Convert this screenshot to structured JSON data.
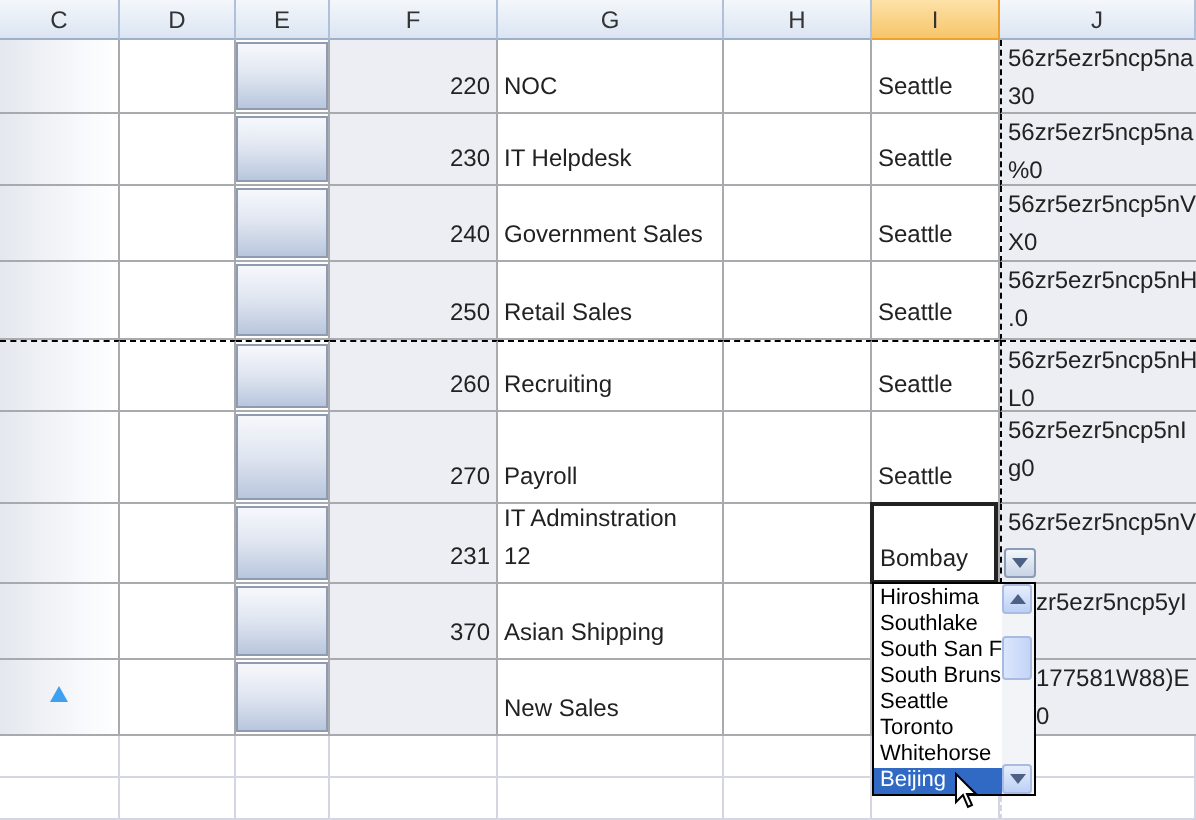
{
  "columns": [
    {
      "label": "C",
      "selected": false
    },
    {
      "label": "D",
      "selected": false
    },
    {
      "label": "E",
      "selected": false
    },
    {
      "label": "F",
      "selected": false
    },
    {
      "label": "G",
      "selected": false
    },
    {
      "label": "H",
      "selected": false
    },
    {
      "label": "I",
      "selected": true
    },
    {
      "label": "J",
      "selected": false
    }
  ],
  "rows": [
    {
      "new_row": false,
      "editing": false,
      "dashed_top": false,
      "f": "220",
      "g": [
        "NOC"
      ],
      "i": "Seattle",
      "j": [
        "56zr5ezr5ncp5na",
        "30"
      ]
    },
    {
      "new_row": false,
      "editing": false,
      "dashed_top": false,
      "f": "230",
      "g": [
        "IT Helpdesk"
      ],
      "i": "Seattle",
      "j": [
        "56zr5ezr5ncp5na",
        "%0"
      ]
    },
    {
      "new_row": false,
      "editing": false,
      "dashed_top": false,
      "f": "240",
      "g": [
        "Government Sales"
      ],
      "i": "Seattle",
      "j": [
        "56zr5ezr5ncp5nV",
        "X0"
      ]
    },
    {
      "new_row": false,
      "editing": false,
      "dashed_top": false,
      "f": "250",
      "g": [
        "Retail Sales"
      ],
      "i": "Seattle",
      "j": [
        "56zr5ezr5ncp5nH",
        ".0"
      ]
    },
    {
      "new_row": false,
      "editing": false,
      "dashed_top": true,
      "f": "260",
      "g": [
        "Recruiting"
      ],
      "i": "Seattle",
      "j": [
        "56zr5ezr5ncp5nH",
        "L0"
      ]
    },
    {
      "new_row": false,
      "editing": false,
      "dashed_top": false,
      "f": "270",
      "g": [
        "Payroll"
      ],
      "i": "Seattle",
      "j": [
        "56zr5ezr5ncp5nI",
        "g0"
      ]
    },
    {
      "new_row": false,
      "editing": true,
      "dashed_top": false,
      "f": "231",
      "g": [
        "IT Adminstration",
        "12"
      ],
      "i": "Bombay",
      "j": [
        "56zr5ezr5ncp5nV"
      ]
    },
    {
      "new_row": false,
      "editing": false,
      "dashed_top": false,
      "f": "370",
      "g": [
        "Asian Shipping"
      ],
      "j": [
        "zr5ezr5ncp5yI"
      ]
    },
    {
      "new_row": true,
      "editing": false,
      "dashed_top": false,
      "g": [
        "New Sales"
      ],
      "j": [
        "177581W88)E",
        "0"
      ]
    }
  ],
  "dropdown": {
    "items": [
      {
        "label": "Hiroshima",
        "selected": false
      },
      {
        "label": "Southlake",
        "selected": false
      },
      {
        "label": "South San F",
        "selected": false
      },
      {
        "label": "South Bruns",
        "selected": false
      },
      {
        "label": "Seattle",
        "selected": false
      },
      {
        "label": "Toronto",
        "selected": false
      },
      {
        "label": "Whitehorse",
        "selected": false
      },
      {
        "label": "Beijing",
        "selected": true
      }
    ]
  }
}
